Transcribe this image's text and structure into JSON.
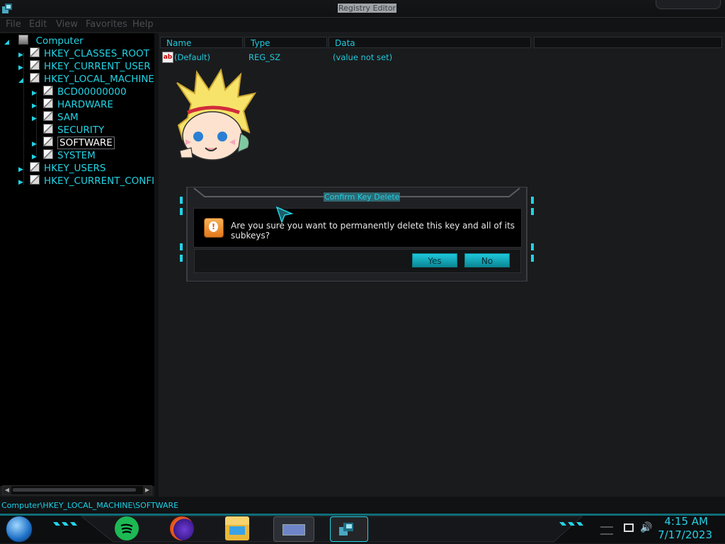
{
  "window": {
    "title": "Registry Editor"
  },
  "menu": [
    "File",
    "Edit",
    "View",
    "Favorites",
    "Help"
  ],
  "tree": {
    "root": "Computer",
    "items": [
      {
        "label": "HKEY_CLASSES_ROOT",
        "level": 1
      },
      {
        "label": "HKEY_CURRENT_USER",
        "level": 1
      },
      {
        "label": "HKEY_LOCAL_MACHINE",
        "level": 1,
        "expanded": true
      },
      {
        "label": "BCD00000000",
        "level": 2
      },
      {
        "label": "HARDWARE",
        "level": 2
      },
      {
        "label": "SAM",
        "level": 2
      },
      {
        "label": "SECURITY",
        "level": 2
      },
      {
        "label": "SOFTWARE",
        "level": 2,
        "selected": true
      },
      {
        "label": "SYSTEM",
        "level": 2
      },
      {
        "label": "HKEY_USERS",
        "level": 1
      },
      {
        "label": "HKEY_CURRENT_CONFI",
        "level": 1
      }
    ]
  },
  "list": {
    "columns": [
      "Name",
      "Type",
      "Data"
    ],
    "rows": [
      {
        "name": "(Default)",
        "type": "REG_SZ",
        "data": "(value not set)"
      }
    ]
  },
  "status": {
    "path": "Computer\\HKEY_LOCAL_MACHINE\\SOFTWARE"
  },
  "dialog": {
    "title": "Confirm Key Delete",
    "message": "Are you sure you want to permanently delete this key and all of its subkeys?",
    "yes_label": "Yes",
    "no_label": "No"
  },
  "clock": {
    "time": "4:15 AM",
    "date": "7/17/2023"
  },
  "colors": {
    "accent": "#22d3e5",
    "dialog_button": "#1ec8db"
  }
}
